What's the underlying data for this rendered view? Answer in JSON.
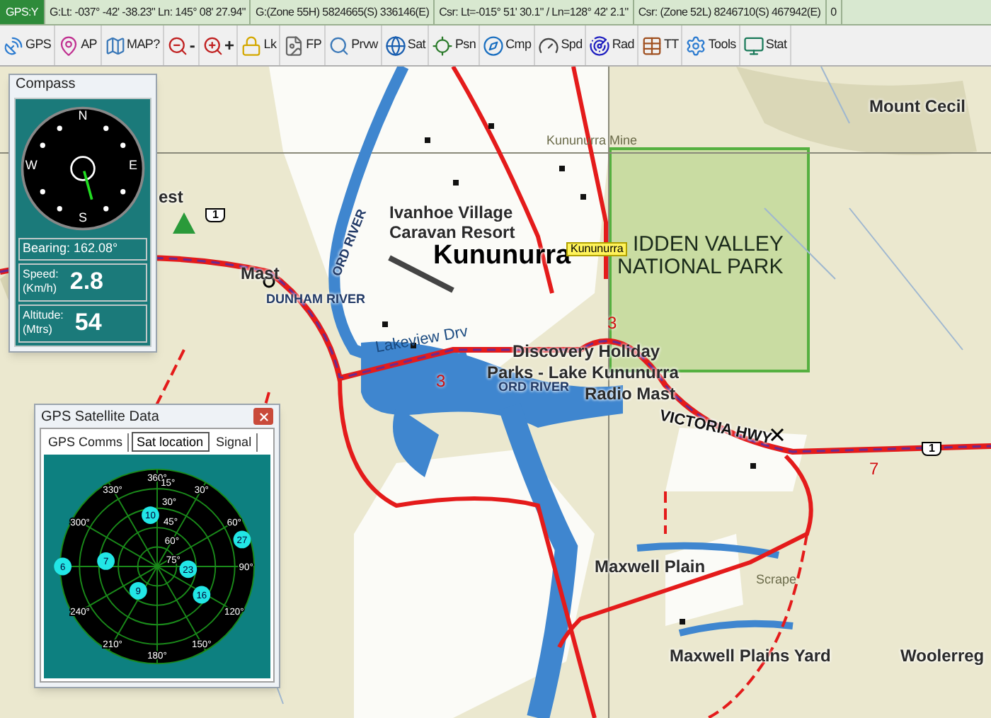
{
  "status_bar": [
    {
      "text": "GPS:Y",
      "kind": "gps"
    },
    {
      "text": "G:Lt: -037° -42' -38.23\" Ln: 145° 08' 27.94\"",
      "kind": "field"
    },
    {
      "text": "G:(Zone 55H)  5824665(S) 336146(E)",
      "kind": "field"
    },
    {
      "text": "Csr: Lt=-015° 51' 30.1\" / Ln=128° 42' 2.1\"",
      "kind": "field"
    },
    {
      "text": "Csr: (Zone 52L)  8246710(S) 467942(E)",
      "kind": "field"
    },
    {
      "text": "0",
      "kind": "field"
    }
  ],
  "toolbar": [
    {
      "label": "GPS",
      "kind": "gps"
    },
    {
      "label": "AP",
      "kind": "pin"
    },
    {
      "label": "MAP?",
      "kind": "map"
    },
    {
      "label": "-",
      "kind": "zoomout"
    },
    {
      "label": "+",
      "kind": "zoomin"
    },
    {
      "label": "Lk",
      "kind": "lock"
    },
    {
      "label": "FP",
      "kind": "file"
    },
    {
      "label": "Prvw",
      "kind": "preview"
    },
    {
      "label": "Sat",
      "kind": "globe"
    },
    {
      "label": "Psn",
      "kind": "position"
    },
    {
      "label": "Cmp",
      "kind": "compass"
    },
    {
      "label": "Spd",
      "kind": "gauge"
    },
    {
      "label": "Rad",
      "kind": "radar"
    },
    {
      "label": "TT",
      "kind": "table"
    },
    {
      "label": "Tools",
      "kind": "tools"
    },
    {
      "label": "Stat",
      "kind": "stat"
    }
  ],
  "map": {
    "labels": [
      {
        "text": "Mount Cecil",
        "kind": "place"
      },
      {
        "text": "Kununurra Mine",
        "kind": "small"
      },
      {
        "text": "Ivanhoe Village",
        "kind": "place"
      },
      {
        "text": "Caravan Resort",
        "kind": "place"
      },
      {
        "text": "Kununurra",
        "kind": "town"
      },
      {
        "text": "Kununurra",
        "kind": "tag"
      },
      {
        "text": "IDDEN VALLEY",
        "kind": "park"
      },
      {
        "text": "NATIONAL PARK",
        "kind": "park"
      },
      {
        "text": "Mast",
        "kind": "place"
      },
      {
        "text": "DUNHAM RIVER",
        "kind": "river"
      },
      {
        "text": "ORD RIVER",
        "kind": "river"
      },
      {
        "text": "Lakeview Drv",
        "kind": "road"
      },
      {
        "text": "Discovery Holiday",
        "kind": "place"
      },
      {
        "text": "Parks - Lake Kununurra",
        "kind": "place"
      },
      {
        "text": "ORD RIVER",
        "kind": "river"
      },
      {
        "text": "Radio Mast",
        "kind": "place"
      },
      {
        "text": "VICTORIA HWY",
        "kind": "highway"
      },
      {
        "text": "Scrape",
        "kind": "small"
      },
      {
        "text": "Maxwell Plain",
        "kind": "place"
      },
      {
        "text": "Maxwell Plains Yard",
        "kind": "place"
      },
      {
        "text": "Woolerreg",
        "kind": "place"
      },
      {
        "text": "est",
        "kind": "place"
      },
      {
        "text": "1",
        "kind": "shield"
      },
      {
        "text": "1",
        "kind": "shield"
      },
      {
        "text": "3",
        "kind": "roadnum"
      },
      {
        "text": "3",
        "kind": "roadnum"
      },
      {
        "text": "7",
        "kind": "roadnum"
      }
    ]
  },
  "compass": {
    "title": "Compass",
    "cardinals": [
      "N",
      "E",
      "S",
      "W"
    ],
    "bearing": "Bearing: 162.08°",
    "speed_label": "Speed:",
    "speed_unit": "(Km/h)",
    "speed": "2.8",
    "altitude_label": "Altitude:",
    "altitude_unit": "(Mtrs)",
    "altitude": "54"
  },
  "satellite_window": {
    "title": "GPS Satellite Data",
    "tabs": [
      {
        "label": "GPS Comms",
        "selected": false
      },
      {
        "label": "Sat location",
        "selected": true
      },
      {
        "label": "Signal",
        "selected": false
      }
    ],
    "azimuth_labels": [
      "360°",
      "30°",
      "60°",
      "90°",
      "120°",
      "150°",
      "180°",
      "210°",
      "240°",
      "300°",
      "330°"
    ],
    "elevation_labels": [
      "15°",
      "30°",
      "45°",
      "60°",
      "75°"
    ],
    "satellites": [
      "10",
      "27",
      "7",
      "6",
      "23",
      "9",
      "16"
    ]
  }
}
